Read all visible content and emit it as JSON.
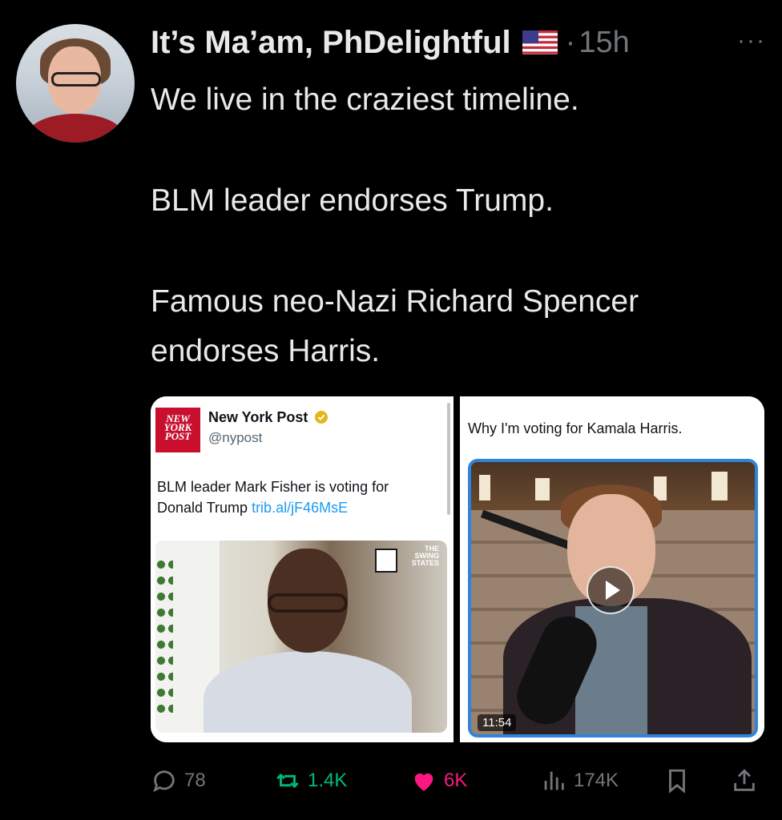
{
  "author": {
    "display_name": "It’s Ma’am, PhDelightful",
    "flag_icon": "us-flag-icon",
    "separator": "·",
    "time": "15h",
    "more": "···"
  },
  "tweet": {
    "lines": [
      "We live in the craziest timeline.",
      "BLM leader endorses Trump.",
      "Famous neo-Nazi Richard Spencer",
      "endorses Harris."
    ]
  },
  "media_left": {
    "logo_lines": [
      "NEW",
      "YORK",
      "POST"
    ],
    "name": "New York Post",
    "handle": "@nypost",
    "text": "BLM leader Mark Fisher is voting for Donald Trump ",
    "link": "trib.al/jF46MsE",
    "badge_lines": [
      "THE",
      "SWING",
      "STATES"
    ]
  },
  "media_right": {
    "caption": "Why I'm voting for Kamala Harris.",
    "duration": "11:54"
  },
  "actions": {
    "replies": "78",
    "retweets": "1.4K",
    "likes": "6K",
    "views": "174K"
  },
  "colors": {
    "accent_link": "#1d9bf0",
    "retweet": "#00ba7c",
    "like": "#f91880",
    "muted": "#71767b"
  }
}
